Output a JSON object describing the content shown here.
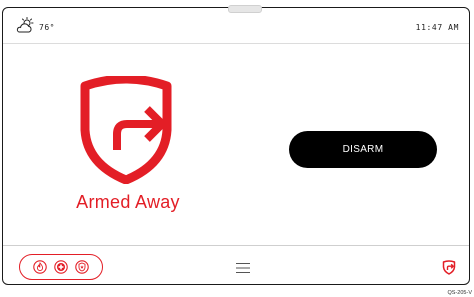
{
  "status_bar": {
    "weather_icon": "partly-cloudy-icon",
    "temperature": "76°",
    "time": "11:47 AM"
  },
  "arm_status": {
    "icon": "shield-arrow-icon",
    "label": "Armed Away",
    "color": "#e31e26"
  },
  "actions": {
    "disarm_label": "DISARM"
  },
  "bottom_bar": {
    "emergency_icons": [
      "fire-icon",
      "medical-icon",
      "police-icon"
    ],
    "menu_icon": "menu-icon",
    "mode_icon": "armed-away-icon"
  },
  "footer": {
    "model_code": "QS-205-V"
  }
}
